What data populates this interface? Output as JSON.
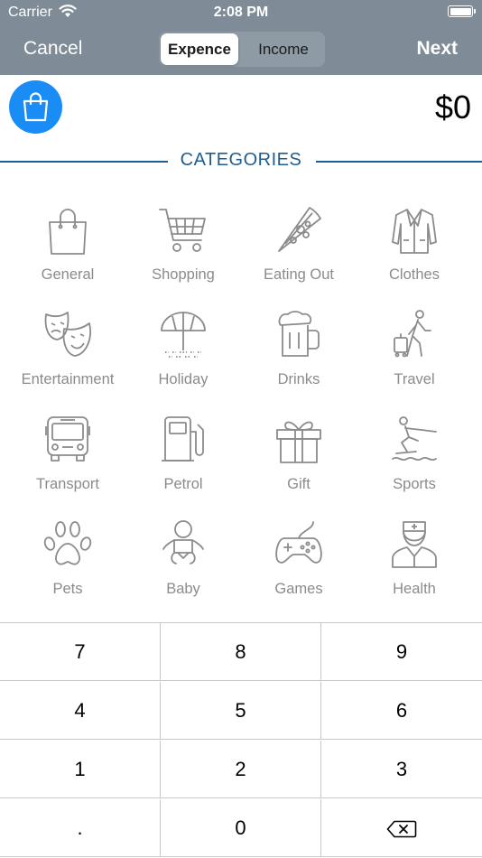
{
  "status_bar": {
    "carrier": "Carrier",
    "time": "2:08 PM"
  },
  "nav": {
    "cancel_label": "Cancel",
    "next_label": "Next",
    "segments": [
      "Expence",
      "Income"
    ],
    "selected_segment": "Expence"
  },
  "selected_category_icon": "shopping-bag-icon",
  "amount": "$0",
  "categories_title": "CATEGORIES",
  "categories": [
    {
      "label": "General",
      "icon": "shopping-bag-icon"
    },
    {
      "label": "Shopping",
      "icon": "shopping-cart-icon"
    },
    {
      "label": "Eating Out",
      "icon": "pizza-slice-icon"
    },
    {
      "label": "Clothes",
      "icon": "jacket-icon"
    },
    {
      "label": "Entertainment",
      "icon": "theater-masks-icon"
    },
    {
      "label": "Holiday",
      "icon": "beach-umbrella-icon"
    },
    {
      "label": "Drinks",
      "icon": "beer-mug-icon"
    },
    {
      "label": "Travel",
      "icon": "traveler-luggage-icon"
    },
    {
      "label": "Transport",
      "icon": "bus-icon"
    },
    {
      "label": "Petrol",
      "icon": "fuel-pump-icon"
    },
    {
      "label": "Gift",
      "icon": "gift-box-icon"
    },
    {
      "label": "Sports",
      "icon": "water-ski-icon"
    },
    {
      "label": "Pets",
      "icon": "paw-print-icon"
    },
    {
      "label": "Baby",
      "icon": "baby-icon"
    },
    {
      "label": "Games",
      "icon": "gamepad-icon"
    },
    {
      "label": "Health",
      "icon": "doctor-icon"
    }
  ],
  "keypad": {
    "keys": [
      "7",
      "8",
      "9",
      "4",
      "5",
      "6",
      "1",
      "2",
      "3",
      ".",
      "0"
    ],
    "delete_icon": "backspace-icon"
  },
  "colors": {
    "header_bg": "#7f8c97",
    "accent_blue": "#1a8cf5",
    "categories_title": "#1f5d91",
    "icon_gray": "#8b8b8b"
  }
}
